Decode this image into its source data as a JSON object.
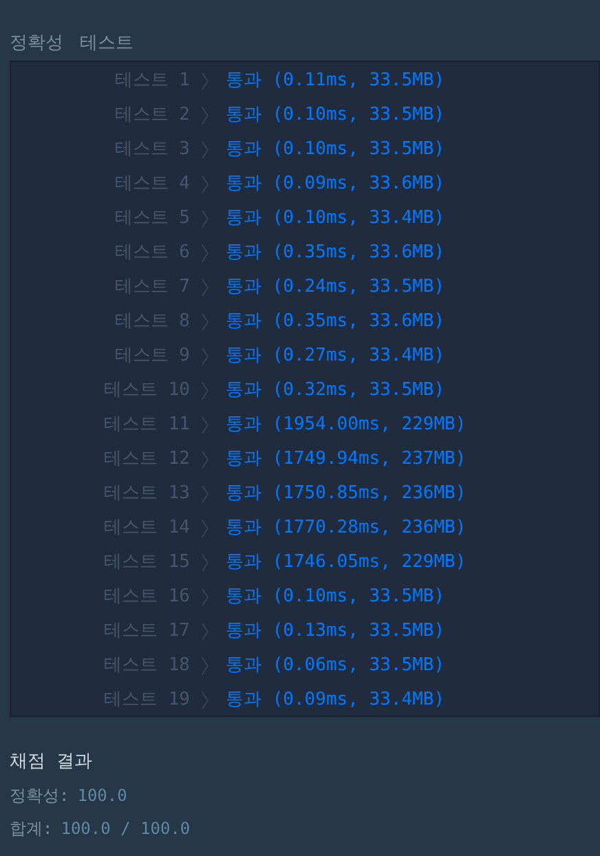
{
  "header": {
    "title": "정확성",
    "subtitle": "테스트"
  },
  "tests": [
    {
      "label": "테스트 1",
      "kind": "passed",
      "result": "통과 (0.11ms, 33.5MB)"
    },
    {
      "label": "테스트 2",
      "kind": "passed",
      "result": "통과 (0.10ms, 33.5MB)"
    },
    {
      "label": "테스트 3",
      "kind": "passed",
      "result": "통과 (0.10ms, 33.5MB)"
    },
    {
      "label": "테스트 4",
      "kind": "passed",
      "result": "통과 (0.09ms, 33.6MB)"
    },
    {
      "label": "테스트 5",
      "kind": "passed",
      "result": "통과 (0.10ms, 33.4MB)"
    },
    {
      "label": "테스트 6",
      "kind": "passed",
      "result": "통과 (0.35ms, 33.6MB)"
    },
    {
      "label": "테스트 7",
      "kind": "passed",
      "result": "통과 (0.24ms, 33.5MB)"
    },
    {
      "label": "테스트 8",
      "kind": "passed",
      "result": "통과 (0.35ms, 33.6MB)"
    },
    {
      "label": "테스트 9",
      "kind": "passed",
      "result": "통과 (0.27ms, 33.4MB)"
    },
    {
      "label": "테스트 10",
      "kind": "passed",
      "result": "통과 (0.32ms, 33.5MB)"
    },
    {
      "label": "테스트 11",
      "kind": "passed",
      "result": "통과 (1954.00ms, 229MB)"
    },
    {
      "label": "테스트 12",
      "kind": "passed",
      "result": "통과 (1749.94ms, 237MB)"
    },
    {
      "label": "테스트 13",
      "kind": "passed",
      "result": "통과 (1750.85ms, 236MB)"
    },
    {
      "label": "테스트 14",
      "kind": "passed",
      "result": "통과 (1770.28ms, 236MB)"
    },
    {
      "label": "테스트 15",
      "kind": "passed",
      "result": "통과 (1746.05ms, 229MB)"
    },
    {
      "label": "테스트 16",
      "kind": "passed",
      "result": "통과 (0.10ms, 33.5MB)"
    },
    {
      "label": "테스트 17",
      "kind": "passed",
      "result": "통과 (0.13ms, 33.5MB)"
    },
    {
      "label": "테스트 18",
      "kind": "passed",
      "result": "통과 (0.06ms, 33.5MB)"
    },
    {
      "label": "테스트 19",
      "kind": "passed",
      "result": "통과 (0.09ms, 33.4MB)"
    }
  ],
  "summary": {
    "title": "채점 결과",
    "lines": [
      {
        "label": "정확성:",
        "value": "100.0"
      },
      {
        "label": "합계:",
        "value": "100.0 / 100.0"
      }
    ]
  }
}
